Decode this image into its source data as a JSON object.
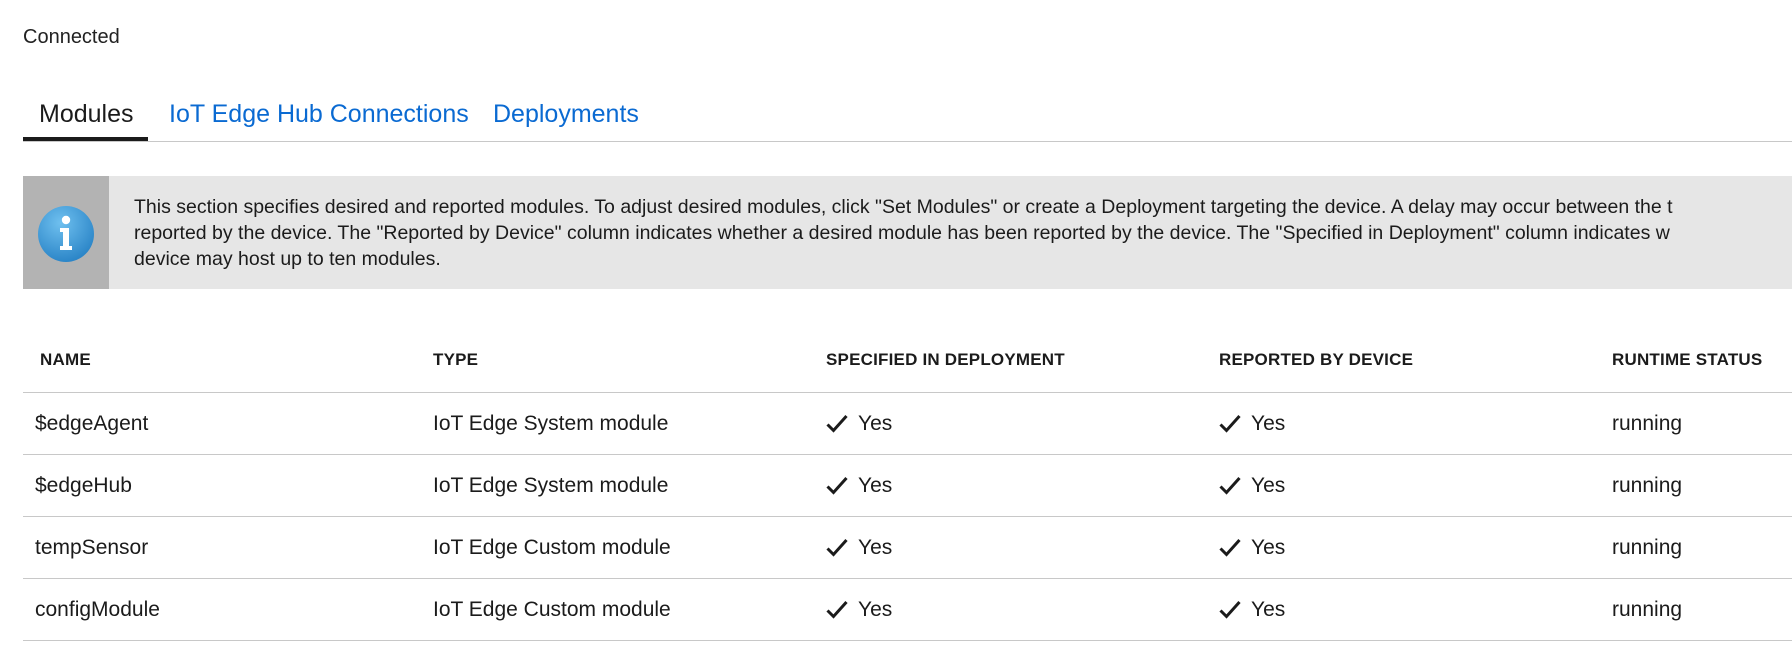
{
  "status": "Connected",
  "tabs": [
    {
      "label": "Modules",
      "active": true
    },
    {
      "label": "IoT Edge Hub Connections",
      "active": false
    },
    {
      "label": "Deployments",
      "active": false
    }
  ],
  "info": {
    "icon": "info-icon",
    "text": "This section specifies desired and reported modules.  To adjust desired modules, click \"Set Modules\" or create a Deployment targeting the device.  A delay may occur between the t\nreported by the device.  The \"Reported by Device\" column indicates whether a desired module has been reported by the device.  The \"Specified in Deployment\" column indicates w\ndevice may host up to ten modules."
  },
  "table": {
    "headers": [
      "NAME",
      "TYPE",
      "SPECIFIED IN DEPLOYMENT",
      "REPORTED BY DEVICE",
      "RUNTIME STATUS"
    ],
    "rows": [
      {
        "name": "$edgeAgent",
        "type": "IoT Edge System module",
        "specified": "Yes",
        "reported": "Yes",
        "status": "running"
      },
      {
        "name": "$edgeHub",
        "type": "IoT Edge System module",
        "specified": "Yes",
        "reported": "Yes",
        "status": "running"
      },
      {
        "name": "tempSensor",
        "type": "IoT Edge Custom module",
        "specified": "Yes",
        "reported": "Yes",
        "status": "running"
      },
      {
        "name": "configModule",
        "type": "IoT Edge Custom module",
        "specified": "Yes",
        "reported": "Yes",
        "status": "running"
      }
    ]
  },
  "colors": {
    "link": "#0a6ad2",
    "info_bg": "#e6e6e6",
    "info_icon_bg": "#b3b3b3",
    "info_icon": "#3a9ad9"
  }
}
